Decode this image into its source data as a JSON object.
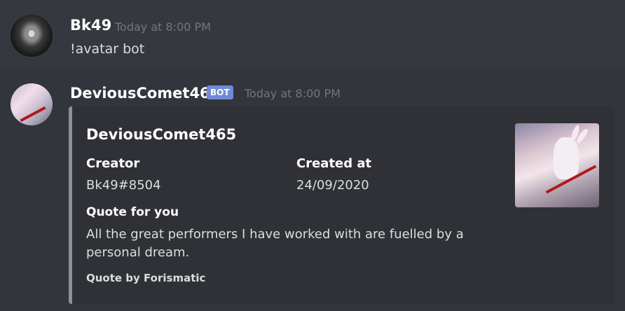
{
  "messages": [
    {
      "username": "Bk49",
      "timestamp": "Today at 8:00 PM",
      "text": "!avatar bot"
    },
    {
      "username": "DeviousComet465",
      "badge": "BOT",
      "timestamp": "Today at 8:00 PM",
      "embed": {
        "title": "DeviousComet465",
        "fields": [
          {
            "name": "Creator",
            "value": "Bk49#8504"
          },
          {
            "name": "Created at",
            "value": "24/09/2020"
          },
          {
            "name": "Quote for you",
            "value": "All the great performers I have worked with are fuelled by a personal dream."
          }
        ],
        "footer": "Quote by Forismatic"
      }
    }
  ],
  "colors": {
    "background": "#36393f",
    "embed_background": "#2f3136",
    "embed_border": "#8e9297",
    "bot_badge": "#7289da",
    "timestamp": "#72767d"
  }
}
